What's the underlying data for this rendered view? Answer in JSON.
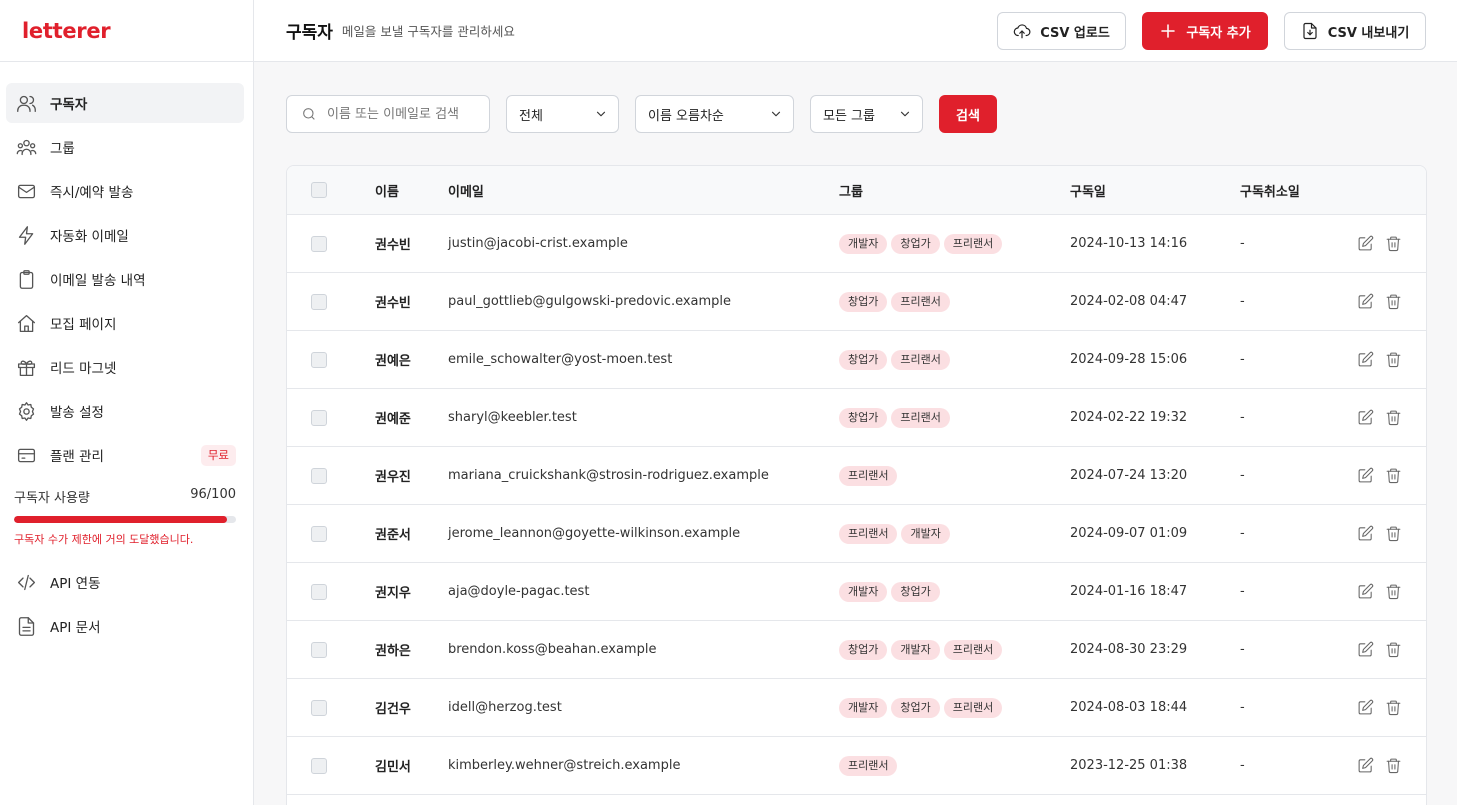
{
  "app": {
    "logo": "letterer"
  },
  "sidebar": {
    "items": [
      {
        "label": "구독자",
        "icon": "users-icon",
        "active": true
      },
      {
        "label": "그룹",
        "icon": "group-icon"
      },
      {
        "label": "즉시/예약 발송",
        "icon": "mail-icon"
      },
      {
        "label": "자동화 이메일",
        "icon": "lightning-icon"
      },
      {
        "label": "이메일 발송 내역",
        "icon": "clipboard-icon"
      },
      {
        "label": "모집 페이지",
        "icon": "home-icon"
      },
      {
        "label": "리드 마그넷",
        "icon": "gift-icon"
      },
      {
        "label": "발송 설정",
        "icon": "gear-icon"
      },
      {
        "label": "플랜 관리",
        "icon": "credit-card-icon",
        "badge": "무료"
      }
    ],
    "usage": {
      "label": "구독자 사용량",
      "value": "96/100",
      "fraction": 0.96,
      "warning": "구독자 수가 제한에 거의 도달했습니다."
    },
    "bottom_items": [
      {
        "label": "API 연동",
        "icon": "code-icon"
      },
      {
        "label": "API 문서",
        "icon": "document-icon"
      }
    ]
  },
  "header": {
    "title": "구독자",
    "subtitle": "메일을 보낼 구독자를 관리하세요",
    "upload_label": "CSV 업로드",
    "add_label": "구독자 추가",
    "export_label": "CSV 내보내기"
  },
  "filters": {
    "search_placeholder": "이름 또는 이메일로 검색",
    "status": "전체",
    "sort": "이름 오름차순",
    "group": "모든 그룹",
    "search_button": "검색"
  },
  "table": {
    "columns": [
      "이름",
      "이메일",
      "그룹",
      "구독일",
      "구독취소일"
    ],
    "rows": [
      {
        "name": "권수빈",
        "email": "justin@jacobi-crist.example",
        "groups": [
          "개발자",
          "창업가",
          "프리랜서"
        ],
        "subscribed": "2024-10-13 14:16",
        "unsubscribed": "-"
      },
      {
        "name": "권수빈",
        "email": "paul_gottlieb@gulgowski-predovic.example",
        "groups": [
          "창업가",
          "프리랜서"
        ],
        "subscribed": "2024-02-08 04:47",
        "unsubscribed": "-"
      },
      {
        "name": "권예은",
        "email": "emile_schowalter@yost-moen.test",
        "groups": [
          "창업가",
          "프리랜서"
        ],
        "subscribed": "2024-09-28 15:06",
        "unsubscribed": "-"
      },
      {
        "name": "권예준",
        "email": "sharyl@keebler.test",
        "groups": [
          "창업가",
          "프리랜서"
        ],
        "subscribed": "2024-02-22 19:32",
        "unsubscribed": "-"
      },
      {
        "name": "권우진",
        "email": "mariana_cruickshank@strosin-rodriguez.example",
        "groups": [
          "프리랜서"
        ],
        "subscribed": "2024-07-24 13:20",
        "unsubscribed": "-"
      },
      {
        "name": "권준서",
        "email": "jerome_leannon@goyette-wilkinson.example",
        "groups": [
          "프리랜서",
          "개발자"
        ],
        "subscribed": "2024-09-07 01:09",
        "unsubscribed": "-"
      },
      {
        "name": "권지우",
        "email": "aja@doyle-pagac.test",
        "groups": [
          "개발자",
          "창업가"
        ],
        "subscribed": "2024-01-16 18:47",
        "unsubscribed": "-"
      },
      {
        "name": "권하은",
        "email": "brendon.koss@beahan.example",
        "groups": [
          "창업가",
          "개발자",
          "프리랜서"
        ],
        "subscribed": "2024-08-30 23:29",
        "unsubscribed": "-"
      },
      {
        "name": "김건우",
        "email": "idell@herzog.test",
        "groups": [
          "개발자",
          "창업가",
          "프리랜서"
        ],
        "subscribed": "2024-08-03 18:44",
        "unsubscribed": "-"
      },
      {
        "name": "김민서",
        "email": "kimberley.wehner@streich.example",
        "groups": [
          "프리랜서"
        ],
        "subscribed": "2023-12-25 01:38",
        "unsubscribed": "-"
      }
    ]
  },
  "colors": {
    "accent": "#e0202c",
    "tag_bg": "#fbdfe2"
  }
}
